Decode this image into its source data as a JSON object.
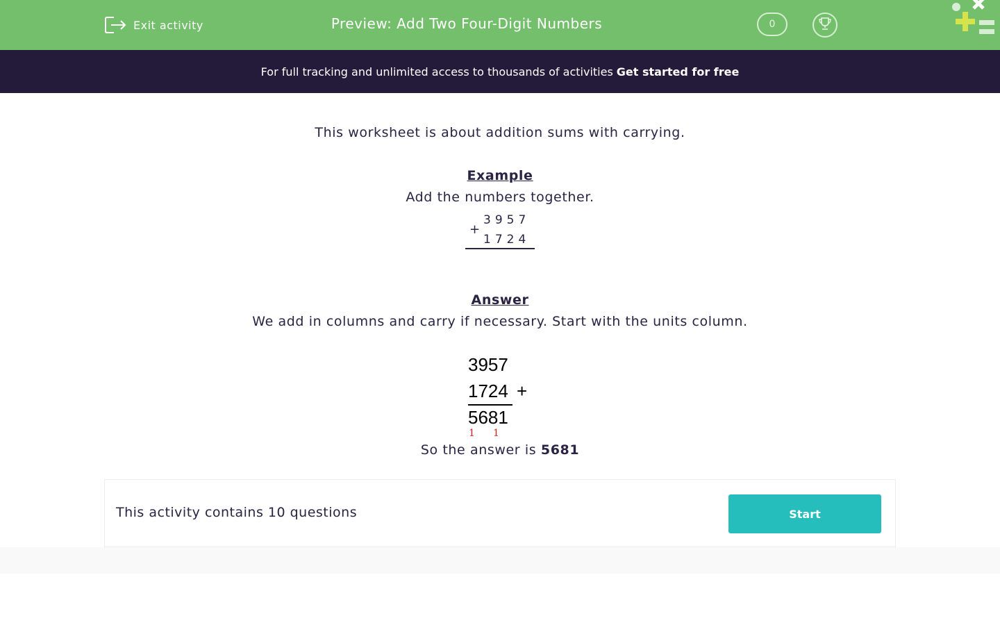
{
  "header": {
    "exit_label": "Exit activity",
    "title": "Preview: Add Two Four-Digit Numbers",
    "score": "0",
    "exit_icon": "exit-icon",
    "trophy_icon": "trophy-icon",
    "bg_color": "#73bf6b"
  },
  "banner": {
    "text": "For full tracking and unlimited access to thousands of activities",
    "cta": "Get started for free",
    "bg_color": "#241b3a"
  },
  "content": {
    "intro": "This worksheet is about addition sums with carrying.",
    "example_heading": "Example",
    "example_instruction": "Add the numbers together.",
    "example_sum": {
      "operator": "+",
      "top": "3957",
      "bottom": "1724"
    },
    "answer_heading": "Answer",
    "answer_explanation": "We add in columns and carry if necessary.  Start with the units column.",
    "worked_sum": {
      "top": "3957",
      "bottom": "1724",
      "operator": "+",
      "result": "5681",
      "carry_1": "1",
      "carry_2": "1"
    },
    "conclusion_prefix": "So the answer is",
    "conclusion_value": "5681"
  },
  "footer": {
    "info": "This activity contains 10 questions",
    "start_label": "Start",
    "button_color": "#26bdbd"
  }
}
